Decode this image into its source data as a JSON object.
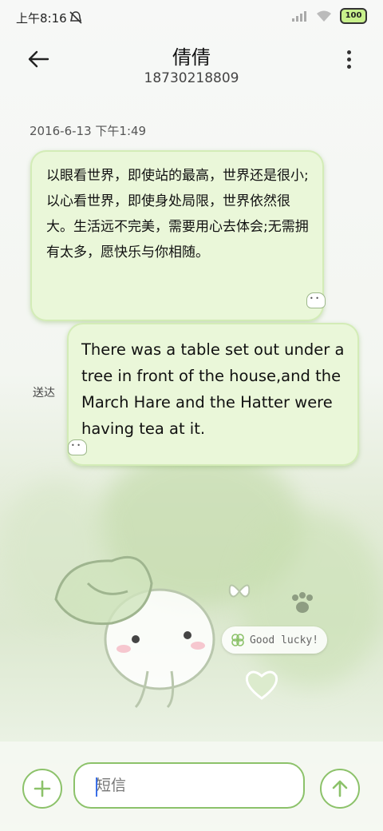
{
  "status_bar": {
    "time": "上午8:16",
    "battery": "100",
    "icons": [
      "mute-alarm-icon",
      "signal-icon",
      "wifi-icon",
      "battery-icon"
    ]
  },
  "header": {
    "back_icon": "back-arrow-icon",
    "contact_name": "倩倩",
    "phone_number": "18730218809",
    "more_icon": "more-vertical-icon"
  },
  "conversation": {
    "timestamp": "2016-6-13 下午1:49",
    "messages": [
      {
        "direction": "incoming",
        "text": "以眼看世界，即使站的最高，世界还是很小;以心看世界，即使身处局限，世界依然很大。生活远不完美，需要用心去体会;无需拥有太多，愿快乐与你相随。"
      },
      {
        "direction": "outgoing",
        "text": "There was a table set out under a tree in front of the house,and the March Hare and the Hatter were having tea at it.",
        "status": "送达"
      }
    ]
  },
  "decorations": {
    "lucky_text": "Good lucky!"
  },
  "composer": {
    "placeholder": "短信",
    "add_icon": "plus-icon",
    "send_icon": "arrow-up-icon"
  },
  "colors": {
    "accent": "#8cc26a",
    "bubble_bg": "#eaf7d9",
    "caret": "#3a6fe8"
  }
}
